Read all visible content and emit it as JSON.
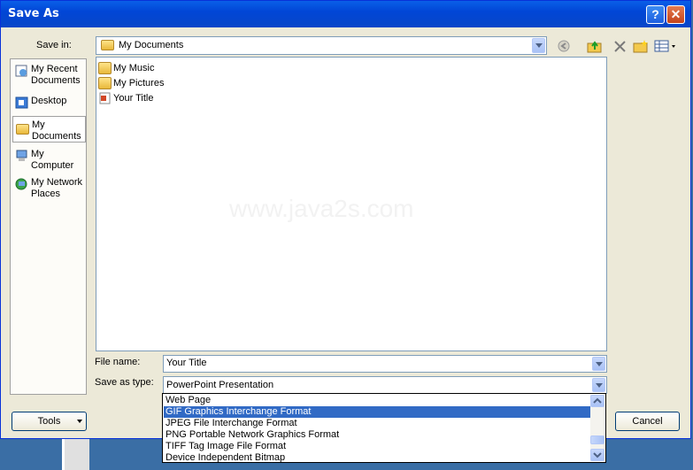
{
  "window": {
    "title": "Save As",
    "help_label": "?",
    "close_label": "✕"
  },
  "save_in": {
    "label": "Save in:",
    "value": "My Documents"
  },
  "toolbar": {
    "icons": [
      "back-icon",
      "up-folder-icon",
      "delete-icon",
      "new-folder-icon",
      "views-icon"
    ]
  },
  "places": [
    {
      "line1": "My Recent",
      "line2": "Documents",
      "icon": "recent-documents-icon"
    },
    {
      "line1": "Desktop",
      "line2": "",
      "icon": "desktop-icon"
    },
    {
      "line1": "My",
      "line2": "Documents",
      "icon": "my-documents-icon"
    },
    {
      "line1": "My",
      "line2": "Computer",
      "icon": "my-computer-icon"
    },
    {
      "line1": "My Network",
      "line2": "Places",
      "icon": "network-places-icon"
    }
  ],
  "files": [
    {
      "name": "My Music",
      "icon": "music-folder-icon"
    },
    {
      "name": "My Pictures",
      "icon": "pictures-folder-icon"
    },
    {
      "name": "Your Title",
      "icon": "powerpoint-file-icon"
    }
  ],
  "watermark": "www.java2s.com",
  "file_name": {
    "label": "File name:",
    "value": "Your Title"
  },
  "save_as_type": {
    "label": "Save as type:",
    "value": "PowerPoint Presentation",
    "options": [
      "Web Page",
      "GIF Graphics Interchange Format",
      "JPEG File Interchange Format",
      "PNG Portable Network Graphics Format",
      "TIFF Tag Image File Format",
      "Device Independent Bitmap"
    ],
    "selected_index": 1
  },
  "buttons": {
    "tools": "Tools",
    "cancel": "Cancel"
  },
  "colors": {
    "titlebar": "#0146d6",
    "selection": "#316ac5",
    "dialog": "#ece9d8"
  }
}
